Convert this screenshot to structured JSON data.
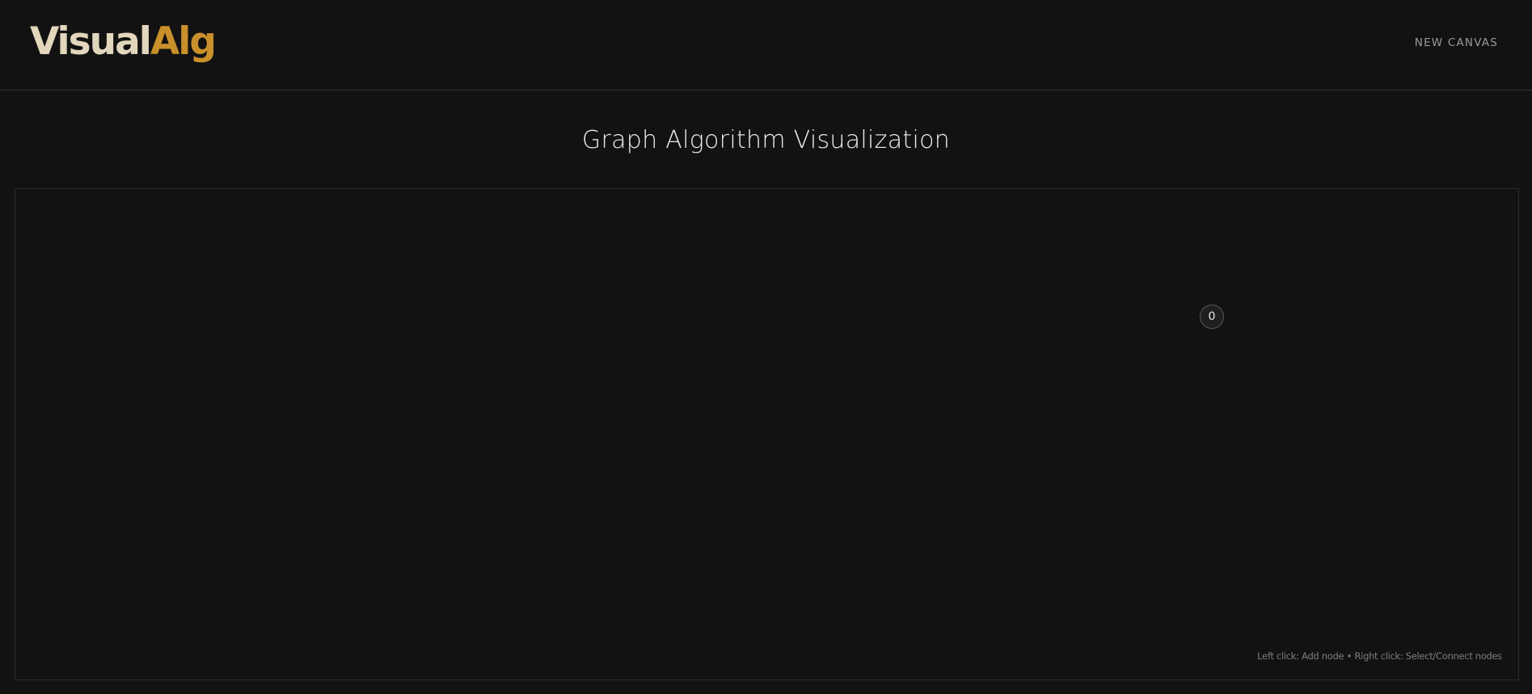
{
  "header": {
    "logo_part1": "Visual",
    "logo_part2": "Alg",
    "nav_button": "NEW CANVAS"
  },
  "main": {
    "title": "Graph Algorithm Visualization"
  },
  "canvas": {
    "nodes": [
      {
        "label": "0"
      }
    ],
    "hint": "Left click: Add node • Right click: Select/Connect nodes"
  },
  "colors": {
    "background": "#121212",
    "logo_light": "#e2d6bd",
    "logo_accent": "#c98f2a",
    "border": "#2c2c2c"
  }
}
